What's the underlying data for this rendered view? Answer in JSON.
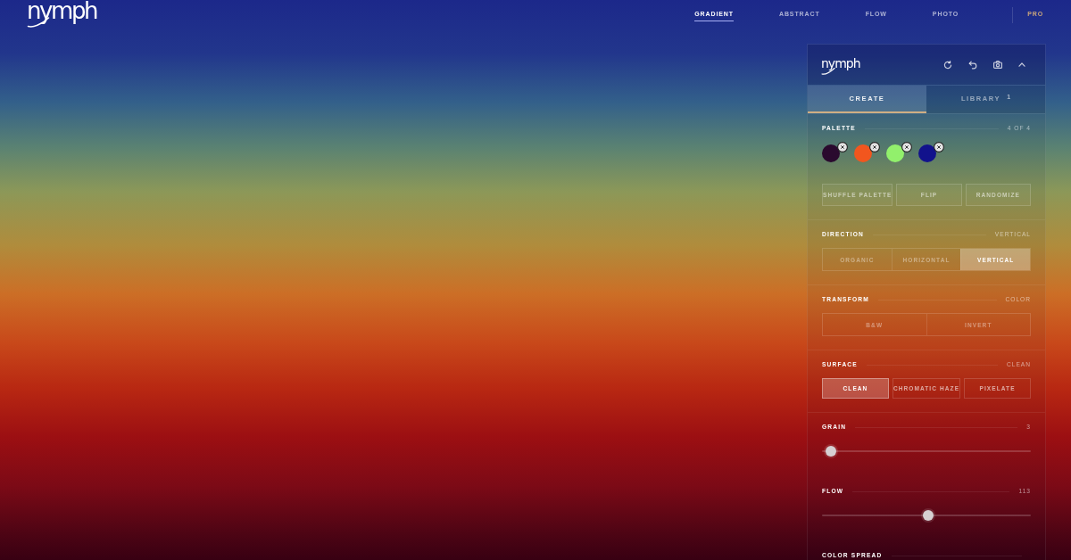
{
  "header": {
    "logo": "nymph",
    "nav": [
      {
        "label": "GRADIENT",
        "selected": true
      },
      {
        "label": "ABSTRACT",
        "selected": false
      },
      {
        "label": "FLOW",
        "selected": false
      },
      {
        "label": "PHOTO",
        "selected": false
      }
    ],
    "pro": "PRO"
  },
  "panel": {
    "logo": "nymph",
    "tabs": [
      {
        "label": "CREATE",
        "selected": true
      },
      {
        "label": "LIBRARY",
        "selected": false,
        "count": "1"
      }
    ],
    "sections": [
      {
        "kind": "palette",
        "label": "PALETTE",
        "value": "4 OF 4",
        "swatches": [
          {
            "color": "#2a0a2e"
          },
          {
            "color": "#f2561e"
          },
          {
            "color": "#92f06c"
          },
          {
            "color": "#12128c"
          }
        ],
        "buttons": [
          "SHUFFLE PALETTE",
          "FLIP",
          "RANDOMIZE"
        ]
      },
      {
        "kind": "segmented",
        "label": "DIRECTION",
        "value": "VERTICAL",
        "options": [
          {
            "label": "ORGANIC",
            "selected": false
          },
          {
            "label": "HORIZONTAL",
            "selected": false
          },
          {
            "label": "VERTICAL",
            "selected": true
          }
        ]
      },
      {
        "kind": "segmented",
        "label": "TRANSFORM",
        "value": "COLOR",
        "options": [
          {
            "label": "B&W",
            "selected": false
          },
          {
            "label": "INVERT",
            "selected": false
          }
        ]
      },
      {
        "kind": "choices",
        "label": "SURFACE",
        "value": "CLEAN",
        "options": [
          {
            "label": "CLEAN",
            "selected": true
          },
          {
            "label": "CHROMATIC HAZE",
            "selected": false
          },
          {
            "label": "PIXELATE",
            "selected": false
          }
        ]
      },
      {
        "kind": "slider",
        "label": "GRAIN",
        "value": "3",
        "level": 0.02
      },
      {
        "kind": "slider",
        "label": "FLOW",
        "value": "113",
        "level": 0.51
      },
      {
        "kind": "slider",
        "label": "COLOR SPREAD"
      }
    ]
  }
}
